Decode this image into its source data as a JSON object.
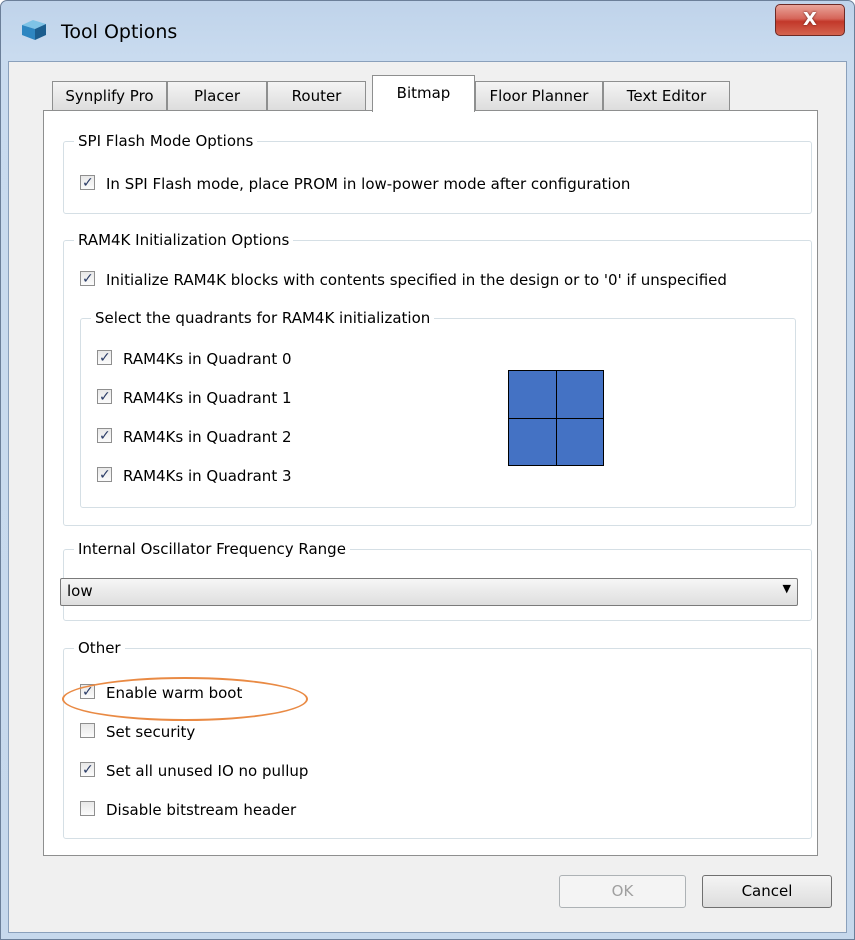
{
  "window": {
    "title": "Tool Options",
    "close_label": "X"
  },
  "tabs": [
    {
      "label": "Synplify Pro"
    },
    {
      "label": "Placer"
    },
    {
      "label": "Router"
    },
    {
      "label": "Bitmap",
      "active": true
    },
    {
      "label": "Floor Planner"
    },
    {
      "label": "Text Editor"
    }
  ],
  "spi": {
    "legend": "SPI Flash Mode Options",
    "low_power": {
      "label": "In SPI Flash mode, place PROM in low-power mode after configuration",
      "checked": true
    }
  },
  "ram4k": {
    "legend": "RAM4K Initialization Options",
    "init": {
      "label": "Initialize RAM4K blocks with contents specified in the design or to '0' if unspecified",
      "checked": true
    },
    "quadrants": {
      "legend": "Select the quadrants for RAM4K initialization",
      "items": [
        {
          "label": "RAM4Ks in Quadrant 0",
          "checked": true
        },
        {
          "label": "RAM4Ks in Quadrant 1",
          "checked": true
        },
        {
          "label": "RAM4Ks in Quadrant 2",
          "checked": true
        },
        {
          "label": "RAM4Ks in Quadrant 3",
          "checked": true
        }
      ]
    }
  },
  "oscillator": {
    "legend": "Internal Oscillator Frequency Range",
    "value": "low"
  },
  "other": {
    "legend": "Other",
    "items": [
      {
        "label": "Enable warm boot",
        "checked": true
      },
      {
        "label": "Set security",
        "checked": false
      },
      {
        "label": "Set all unused IO no pullup",
        "checked": true
      },
      {
        "label": "Disable bitstream header",
        "checked": false
      }
    ]
  },
  "buttons": {
    "ok": "OK",
    "cancel": "Cancel"
  },
  "colors": {
    "quadrant_fill": "#4472c4",
    "annotation": "#e98a44",
    "close_button": "#c2382a"
  }
}
